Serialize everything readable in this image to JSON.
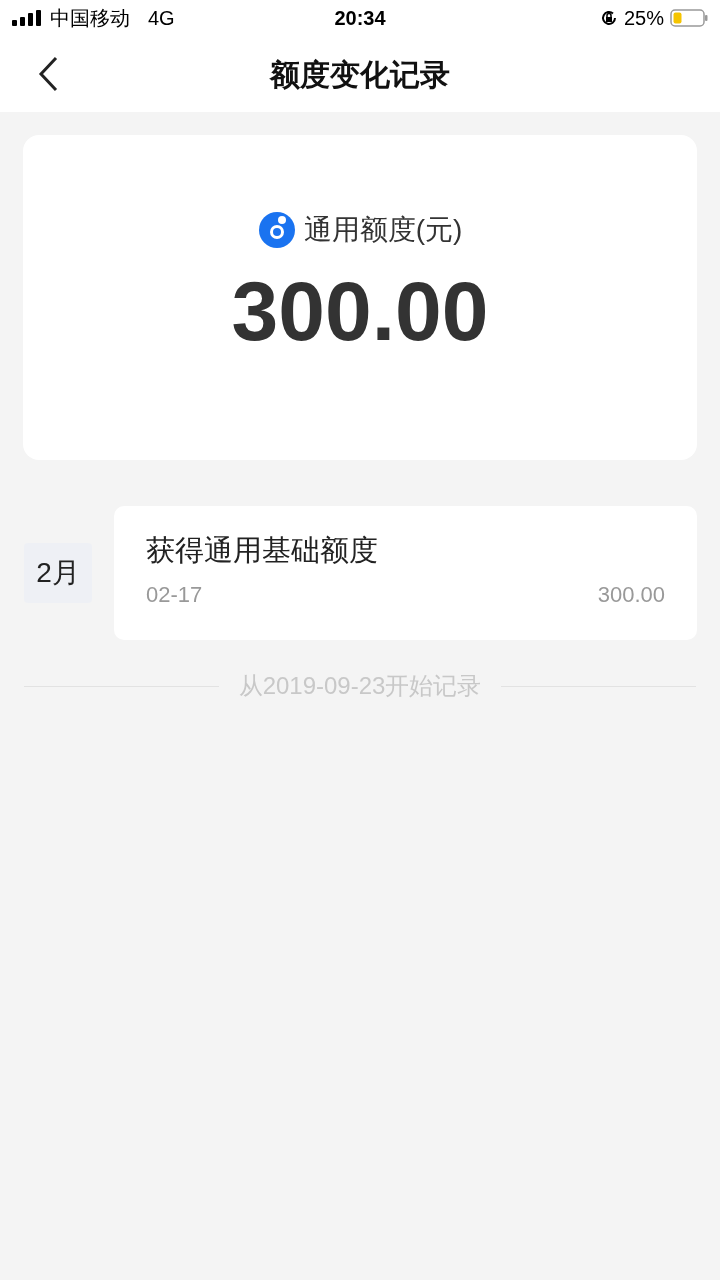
{
  "status_bar": {
    "carrier": "中国移动",
    "network": "4G",
    "time": "20:34",
    "battery": "25%"
  },
  "nav": {
    "title": "额度变化记录"
  },
  "summary": {
    "label": "通用额度(元)",
    "amount": "300.00"
  },
  "groups": [
    {
      "month": "2月",
      "records": [
        {
          "title": "获得通用基础额度",
          "date": "02-17",
          "amount": "300.00"
        }
      ]
    }
  ],
  "footer": "从2019-09-23开始记录"
}
